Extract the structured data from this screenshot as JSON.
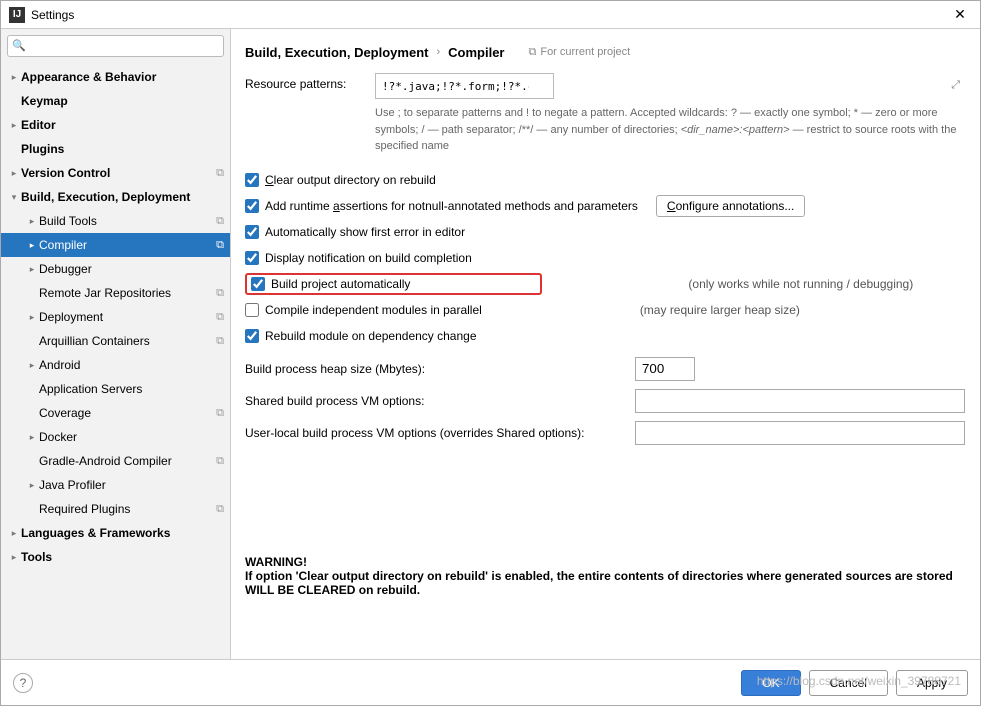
{
  "window": {
    "title": "Settings"
  },
  "search": {
    "placeholder": ""
  },
  "sidebar": {
    "items": [
      {
        "label": "Appearance & Behavior",
        "level": 0,
        "arrow": "▸",
        "bold": true
      },
      {
        "label": "Keymap",
        "level": 0,
        "arrow": "",
        "bold": true
      },
      {
        "label": "Editor",
        "level": 0,
        "arrow": "▸",
        "bold": true
      },
      {
        "label": "Plugins",
        "level": 0,
        "arrow": "",
        "bold": true
      },
      {
        "label": "Version Control",
        "level": 0,
        "arrow": "▸",
        "bold": true,
        "copy": true
      },
      {
        "label": "Build, Execution, Deployment",
        "level": 0,
        "arrow": "▾",
        "bold": true
      },
      {
        "label": "Build Tools",
        "level": 1,
        "arrow": "▸",
        "copy": true
      },
      {
        "label": "Compiler",
        "level": 1,
        "arrow": "▸",
        "selected": true,
        "copy": true
      },
      {
        "label": "Debugger",
        "level": 1,
        "arrow": "▸"
      },
      {
        "label": "Remote Jar Repositories",
        "level": 1,
        "arrow": "",
        "copy": true
      },
      {
        "label": "Deployment",
        "level": 1,
        "arrow": "▸",
        "copy": true
      },
      {
        "label": "Arquillian Containers",
        "level": 1,
        "arrow": "",
        "copy": true
      },
      {
        "label": "Android",
        "level": 1,
        "arrow": "▸"
      },
      {
        "label": "Application Servers",
        "level": 1,
        "arrow": ""
      },
      {
        "label": "Coverage",
        "level": 1,
        "arrow": "",
        "copy": true
      },
      {
        "label": "Docker",
        "level": 1,
        "arrow": "▸"
      },
      {
        "label": "Gradle-Android Compiler",
        "level": 1,
        "arrow": "",
        "copy": true
      },
      {
        "label": "Java Profiler",
        "level": 1,
        "arrow": "▸"
      },
      {
        "label": "Required Plugins",
        "level": 1,
        "arrow": "",
        "copy": true
      },
      {
        "label": "Languages & Frameworks",
        "level": 0,
        "arrow": "▸",
        "bold": true
      },
      {
        "label": "Tools",
        "level": 0,
        "arrow": "▸",
        "bold": true
      }
    ]
  },
  "breadcrumb": {
    "part1": "Build, Execution, Deployment",
    "part2": "Compiler",
    "project_hint": "For current project"
  },
  "patterns": {
    "label": "Resource patterns:",
    "value": "!?*.java;!?*.form;!?*.class;!?*.groovy;!?*.scala;!?*.flex;!?*.kt;!?*.clj;!?*.aj",
    "hint_a": "Use ; to separate patterns and ! to negate a pattern. Accepted wildcards: ? — exactly one symbol; * — zero or more symbols; / — path separator; /**/ — any number of directories; ",
    "hint_b": "<dir_name>:<pattern>",
    "hint_c": " — restrict to source roots with the specified name"
  },
  "checks": {
    "clear_output": "Clear output directory on rebuild",
    "runtime_assert": "Add runtime assertions for notnull-annotated methods and parameters",
    "configure_btn": "Configure annotations...",
    "show_first_error": "Automatically show first error in editor",
    "display_notification": "Display notification on build completion",
    "build_auto": "Build project automatically",
    "build_auto_note": "(only works while not running / debugging)",
    "compile_parallel": "Compile independent modules in parallel",
    "compile_parallel_note": "(may require larger heap size)",
    "rebuild_dep": "Rebuild module on dependency change"
  },
  "fields": {
    "heap_label": "Build process heap size (Mbytes):",
    "heap_value": "700",
    "shared_vm_label": "Shared build process VM options:",
    "shared_vm_value": "",
    "user_vm_label": "User-local build process VM options (overrides Shared options):",
    "user_vm_value": ""
  },
  "warning": {
    "title": "WARNING!",
    "text": "If option 'Clear output directory on rebuild' is enabled, the entire contents of directories where generated sources are stored WILL BE CLEARED on rebuild."
  },
  "footer": {
    "ok": "OK",
    "cancel": "Cancel",
    "apply": "Apply"
  },
  "watermark": "https://blog.csdn.net/weixin_39788721"
}
